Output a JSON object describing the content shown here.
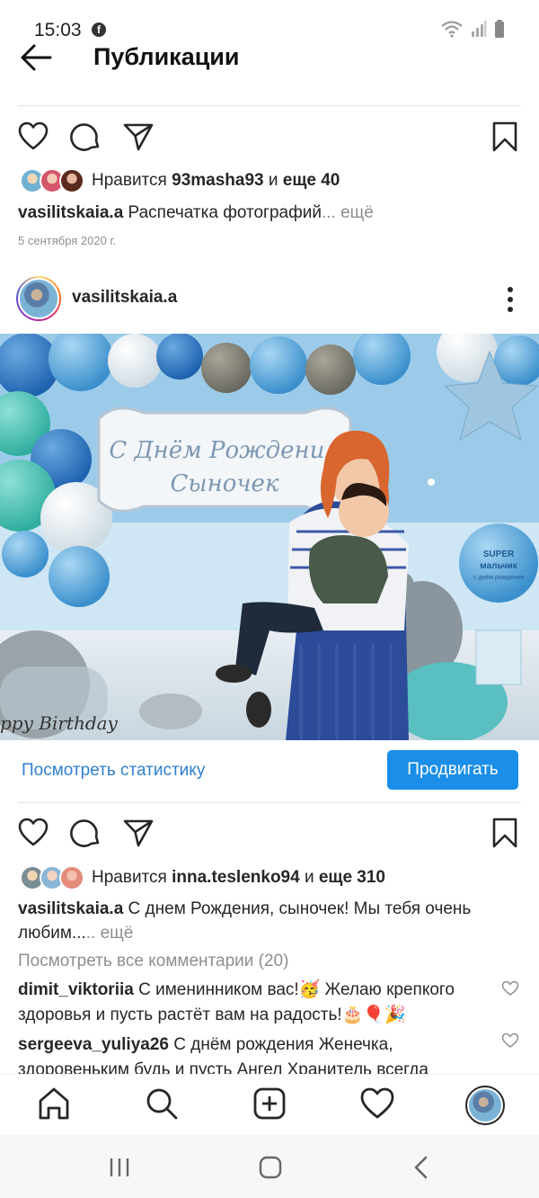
{
  "status_bar": {
    "time": "15:03",
    "fb_glyph": "f",
    "icons": [
      "wifi-icon",
      "signal-icon",
      "battery-icon"
    ]
  },
  "header": {
    "title": "Публикации"
  },
  "post1": {
    "likes": {
      "prefix": "Нравится ",
      "user": "93masha93",
      "middle": " и ",
      "others": "еще 40"
    },
    "caption": {
      "username": "vasilitskaia.a",
      "text": " Распечатка фотографий",
      "more": "... ещё"
    },
    "date": "5 сентября 2020 г."
  },
  "post2": {
    "username": "vasilitskaia.a",
    "photo": {
      "banner_line1": "С Днём Рождения",
      "banner_line2": "Сыночек",
      "balloon_line1": "SUPER",
      "balloon_line2": "мальчик",
      "balloon_line3": "с днём рождения",
      "birthday_text": "ppy Birthday"
    },
    "stats_link": "Посмотреть статистику",
    "promote_label": "Продвигать",
    "likes": {
      "prefix": "Нравится ",
      "user": "inna.teslenko94",
      "middle": " и ",
      "others": "еще 310"
    },
    "caption": {
      "username": "vasilitskaia.a",
      "text": " С днем Рождения, сыночек! Мы тебя очень любим...",
      "more": ".. ещё"
    },
    "view_comments": "Посмотреть все комментарии (20)",
    "comments": [
      {
        "user": "dimit_viktoriia",
        "text": " С именинником вас!🥳 Желаю крепкого здоровья и пусть растёт вам на радость!🎂🎈🎉"
      },
      {
        "user": "sergeeva_yuliya26",
        "text": " С днём рождения Женечка, здоровеньким будь и пусть Ангел Хранитель всегда"
      }
    ]
  },
  "bottom_nav": [
    "home-icon",
    "search-icon",
    "add-post-icon",
    "activity-heart-icon",
    "profile-avatar"
  ],
  "colors": {
    "link_blue": "#2f7fcf",
    "button_blue": "#1a8ee8",
    "text": "#262626",
    "muted": "#8e8e8e"
  }
}
